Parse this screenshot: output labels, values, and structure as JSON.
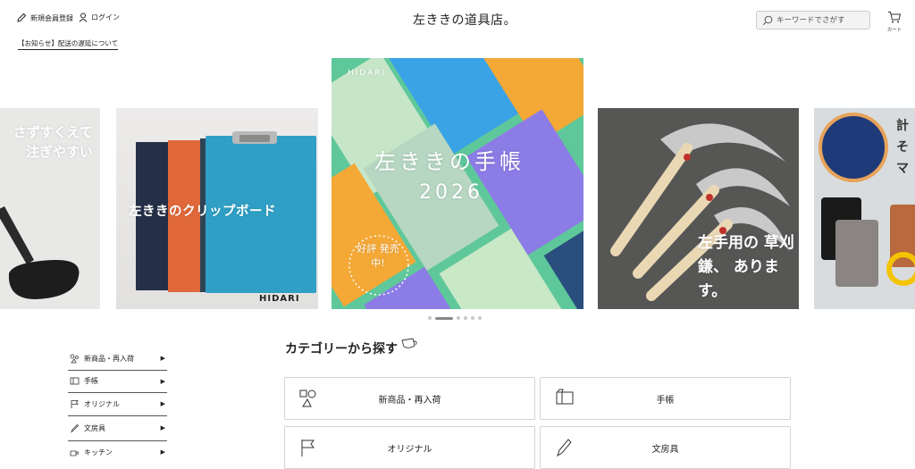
{
  "header": {
    "register_label": "新規会員登録",
    "login_label": "ログイン",
    "logo_text": "左ききの道具店。",
    "search_placeholder": "キーワードでさがす",
    "cart_label": "カート",
    "notice_text": "【お知らせ】配送の遅延について"
  },
  "carousel": {
    "slide1_text": "さずすくえて 注ぎやすい",
    "slide2_text": "左ききのクリップボード",
    "slide2_brand": "HIDARI",
    "slide3_brand": "HIDARI",
    "slide3_title": "左ききの手帳",
    "slide3_year": "2026",
    "slide3_badge": "好評 発売中!",
    "slide4_text": "左手用の 草刈鎌、 あります。",
    "slide5_text": "計 そ マ",
    "dots_count": 6,
    "active_dot": 1
  },
  "sidebar": {
    "items": [
      {
        "label": "新商品・再入荷",
        "icon": "shapes-icon"
      },
      {
        "label": "手帳",
        "icon": "notebook-icon"
      },
      {
        "label": "オリジナル",
        "icon": "flag-icon"
      },
      {
        "label": "文房具",
        "icon": "pen-icon"
      },
      {
        "label": "キッチン",
        "icon": "kitchen-icon"
      }
    ]
  },
  "categories": {
    "title": "カテゴリーから探す",
    "cards": [
      {
        "label": "新商品・再入荷",
        "icon": "shapes-icon"
      },
      {
        "label": "手帳",
        "icon": "notebook-icon"
      },
      {
        "label": "オリジナル",
        "icon": "flag-icon"
      },
      {
        "label": "文房具",
        "icon": "pen-icon"
      }
    ]
  },
  "colors": {
    "accent_green": "#5fc89a",
    "text": "#222222",
    "card_border": "#d3d3d3"
  }
}
